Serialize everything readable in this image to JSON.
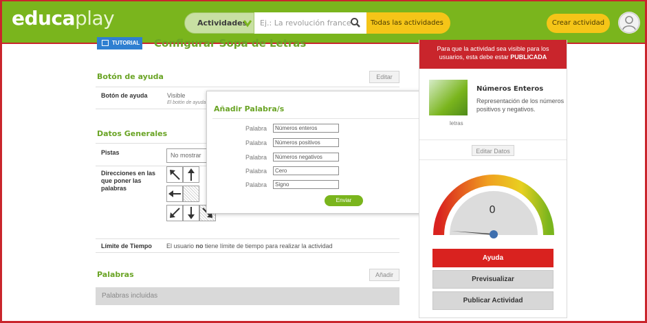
{
  "header": {
    "logo_bold": "educa",
    "logo_light": "play",
    "actividades_label": "Actividades",
    "search_placeholder": "Ej.: La revolución france",
    "todas_label": "Todas las actividades",
    "crear_label": "Crear actividad"
  },
  "main": {
    "tutorial_label": "TUTORIAL",
    "page_title": "Configurar Sopa de Letras",
    "help_section": {
      "title": "Botón de ayuda",
      "edit_label": "Editar",
      "row_label": "Botón de ayuda",
      "row_value": "Visible",
      "row_sub": "El botón de ayuda"
    },
    "general_section": {
      "title": "Datos Generales",
      "pistas_label": "Pistas",
      "pistas_value": "No mostrar pi",
      "direcciones_label": "Direcciones en las que poner las palabras",
      "tiempo_label": "Límite de Tiempo",
      "tiempo_pre": "El usuario ",
      "tiempo_bold": "no",
      "tiempo_post": " tiene límite de tiempo para realizar la actividad"
    },
    "words_section": {
      "title": "Palabras",
      "add_label": "Añadir",
      "included_label": "Palabras incluidas"
    }
  },
  "modal": {
    "title": "Añadir Palabra/s",
    "close_label": "x",
    "field_label": "Palabra",
    "words": [
      "Números enteros",
      "Números positivos",
      "Números negativos",
      "Cero",
      "Signo"
    ],
    "submit_label": "Enviar"
  },
  "sidebar": {
    "banner_line1": "Para que la actividad sea visible para los",
    "banner_line2_pre": "usuarios, esta debe estar ",
    "banner_line2_bold": "PUBLICADA",
    "thumb_caption": "letras",
    "activity_name": "Números Enteros",
    "activity_desc": "Representación de los números positivos y negativos.",
    "edit_data_label": "Editar Datos",
    "gauge_value": "0",
    "ayuda_label": "Ayuda",
    "preview_label": "Previsualizar",
    "publish_label": "Publicar Actividad"
  },
  "colors": {
    "brand_green": "#7ab51d",
    "accent_red": "#c9252c",
    "accent_yellow": "#f5c518"
  }
}
